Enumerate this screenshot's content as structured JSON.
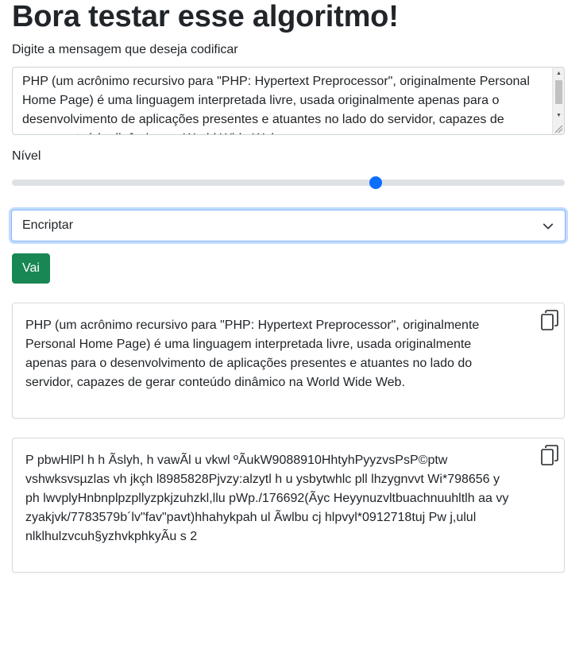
{
  "heading": "Bora testar esse algoritmo!",
  "form": {
    "message_label": "Digite a mensagem que deseja codificar",
    "message_value": "PHP (um acrônimo recursivo para \"PHP: Hypertext Preprocessor\", originalmente Personal Home Page) é uma linguagem interpretada livre, usada originalmente apenas para o desenvolvimento de aplicações presentes e atuantes no lado do servidor, capazes de gerar conteúdo dinâmico na World Wide Web.",
    "level_label": "Nível",
    "level_value_fraction": 0.662,
    "mode_selected": "Encriptar",
    "submit_label": "Vai"
  },
  "results": {
    "original_text": "PHP (um acrônimo recursivo para \"PHP: Hypertext Preprocessor\", originalmente Personal Home Page) é uma linguagem interpretada livre, usada originalmente apenas para o desenvolvimento de aplicações presentes e atuantes no lado do servidor, capazes de gerar conteúdo dinâmico na World Wide Web.",
    "encoded_text": "P pbwHlPl h h Ãslyh, h vawÃl u vkwl ºÃukW9088910HhtyhPyyzvsPsP©ptw vshwksvsµzlas vh jkçh l8985828Pjvzy:alzytl h u ysbytwhlc pll lhzygnvvt Wi*798656 y ph lwvplyHnbnplpzpllyzpkjzuhzkl,llu pWp./176692(Ãyc Heyynuzvltbuachnuuhltlh aa vy zyakjvk/7783579b´lv\"fav\"pavt)hhahykpah ul Ãwlbu cj hlpvyl*0912718tuj Pw j,ulul nlklhulzvcuh§yzhvkphkyÃu s 2"
  },
  "icons": {
    "copy_1": "copy-icon",
    "copy_2": "copy-icon",
    "select_chevron": "chevron-down-icon"
  },
  "colors": {
    "primary": "#0d6efd",
    "success": "#198754",
    "border": "#ced4da"
  }
}
